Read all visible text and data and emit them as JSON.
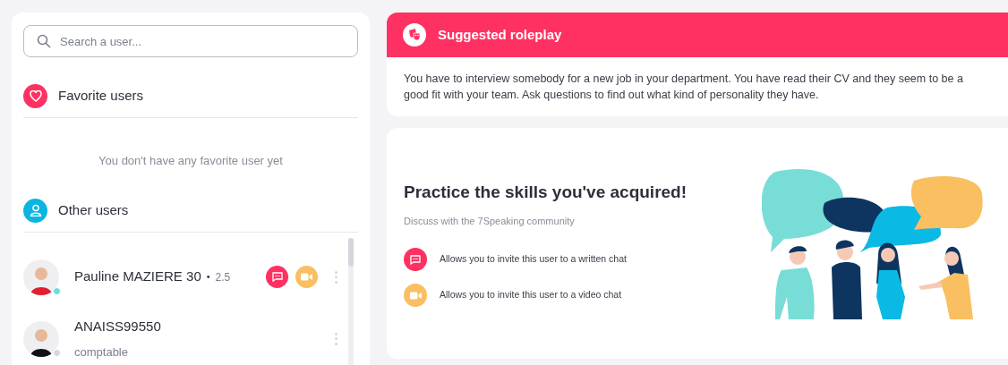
{
  "search": {
    "placeholder": "Search a user..."
  },
  "favorites": {
    "title": "Favorite users",
    "empty_text": "You don't have any favorite user yet"
  },
  "others": {
    "title": "Other users"
  },
  "users": [
    {
      "name": "Pauline MAZIERE 30",
      "separator": "•",
      "rating": "2.5",
      "online": true,
      "actions": true
    },
    {
      "name": "ANAISS99550",
      "subtitle": "comptable",
      "online": false,
      "actions": false
    }
  ],
  "roleplay": {
    "title": "Suggested roleplay",
    "text": "You have to interview somebody for a new job in your department. You have read their CV and they seem to be a good fit with your team. Ask questions to find out what kind of personality they have."
  },
  "practice": {
    "title": "Practice the skills you've acquired!",
    "subtitle": "Discuss with the 7Speaking community",
    "legend": [
      {
        "kind": "chat",
        "text": "Allows you to invite this user to a written chat"
      },
      {
        "kind": "video",
        "text": "Allows you to invite this user to a video chat"
      }
    ]
  }
}
